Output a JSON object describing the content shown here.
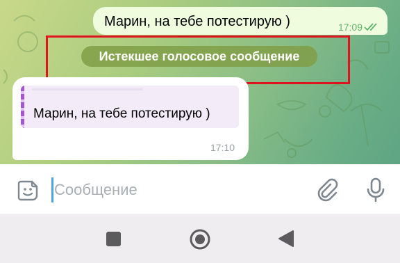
{
  "outgoing_message": {
    "text": "Марин, на тебе потестирую )",
    "time": "17:09"
  },
  "service_message": {
    "text": "Истекшее голосовое сообщение"
  },
  "incoming_message": {
    "reply_quote": "Марин, на тебе потестирую )",
    "time": "17:10"
  },
  "composer": {
    "placeholder": "Сообщение"
  },
  "colors": {
    "outgoing_bubble": "#effdde",
    "service_pill": "#809e46",
    "highlight": "#e0141c",
    "reply_accent": "#a654d6",
    "cursor": "#4ea4e2"
  },
  "icons": [
    "sticker-icon",
    "paperclip-icon",
    "microphone-icon",
    "double-check-icon",
    "recents-icon",
    "home-icon",
    "back-icon"
  ]
}
